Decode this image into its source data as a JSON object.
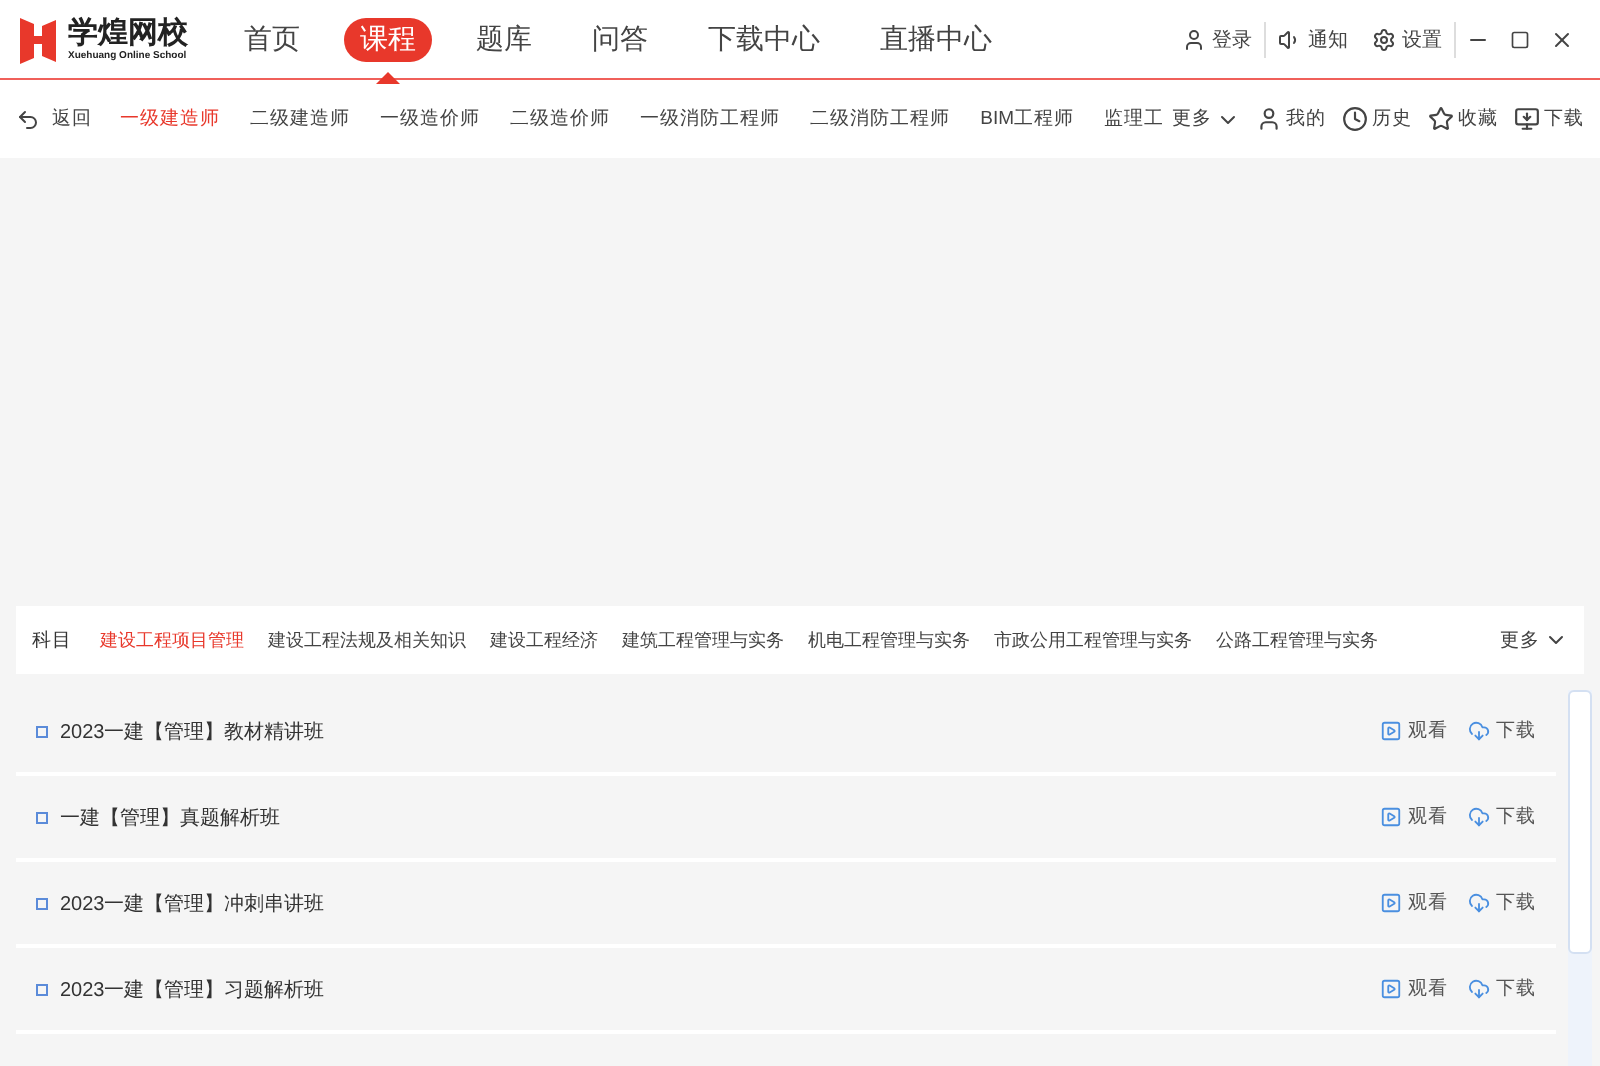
{
  "logo": {
    "title": "学煌网校",
    "subtitle": "Xuehuang Online School"
  },
  "main_nav": [
    {
      "label": "首页",
      "selected": false
    },
    {
      "label": "课程",
      "selected": true
    },
    {
      "label": "题库",
      "selected": false
    },
    {
      "label": "问答",
      "selected": false
    },
    {
      "label": "下载中心",
      "selected": false
    },
    {
      "label": "直播中心",
      "selected": false
    }
  ],
  "top_actions": [
    {
      "kind": "user",
      "label": "登录"
    },
    {
      "kind": "sound",
      "label": "通知"
    },
    {
      "kind": "gear",
      "label": "设置"
    }
  ],
  "back": "返回",
  "exam_tabs": [
    {
      "label": "一级建造师",
      "selected": true
    },
    {
      "label": "二级建造师",
      "selected": false
    },
    {
      "label": "一级造价师",
      "selected": false
    },
    {
      "label": "二级造价师",
      "selected": false
    },
    {
      "label": "一级消防工程师",
      "selected": false
    },
    {
      "label": "二级消防工程师",
      "selected": false
    },
    {
      "label": "BIM工程师",
      "selected": false
    },
    {
      "label": "监理工",
      "selected": false
    }
  ],
  "exam_more": "更多",
  "user_actions": [
    {
      "kind": "user",
      "label": "我的"
    },
    {
      "kind": "clock",
      "label": "历史"
    },
    {
      "kind": "star",
      "label": "收藏"
    },
    {
      "kind": "download",
      "label": "下载"
    }
  ],
  "subjects": {
    "label": "科目",
    "items": [
      {
        "label": "建设工程项目管理",
        "selected": true
      },
      {
        "label": "建设工程法规及相关知识",
        "selected": false
      },
      {
        "label": "建设工程经济",
        "selected": false
      },
      {
        "label": "建筑工程管理与实务",
        "selected": false
      },
      {
        "label": "机电工程管理与实务",
        "selected": false
      },
      {
        "label": "市政公用工程管理与实务",
        "selected": false
      },
      {
        "label": "公路工程管理与实务",
        "selected": false
      }
    ],
    "more": "更多"
  },
  "courses": [
    {
      "title": "2023一建【管理】教材精讲班",
      "watch": "观看",
      "download": "下载"
    },
    {
      "title": "一建【管理】真题解析班",
      "watch": "观看",
      "download": "下载"
    },
    {
      "title": "2023一建【管理】冲刺串讲班",
      "watch": "观看",
      "download": "下载"
    },
    {
      "title": "2023一建【管理】习题解析班",
      "watch": "观看",
      "download": "下载"
    }
  ]
}
